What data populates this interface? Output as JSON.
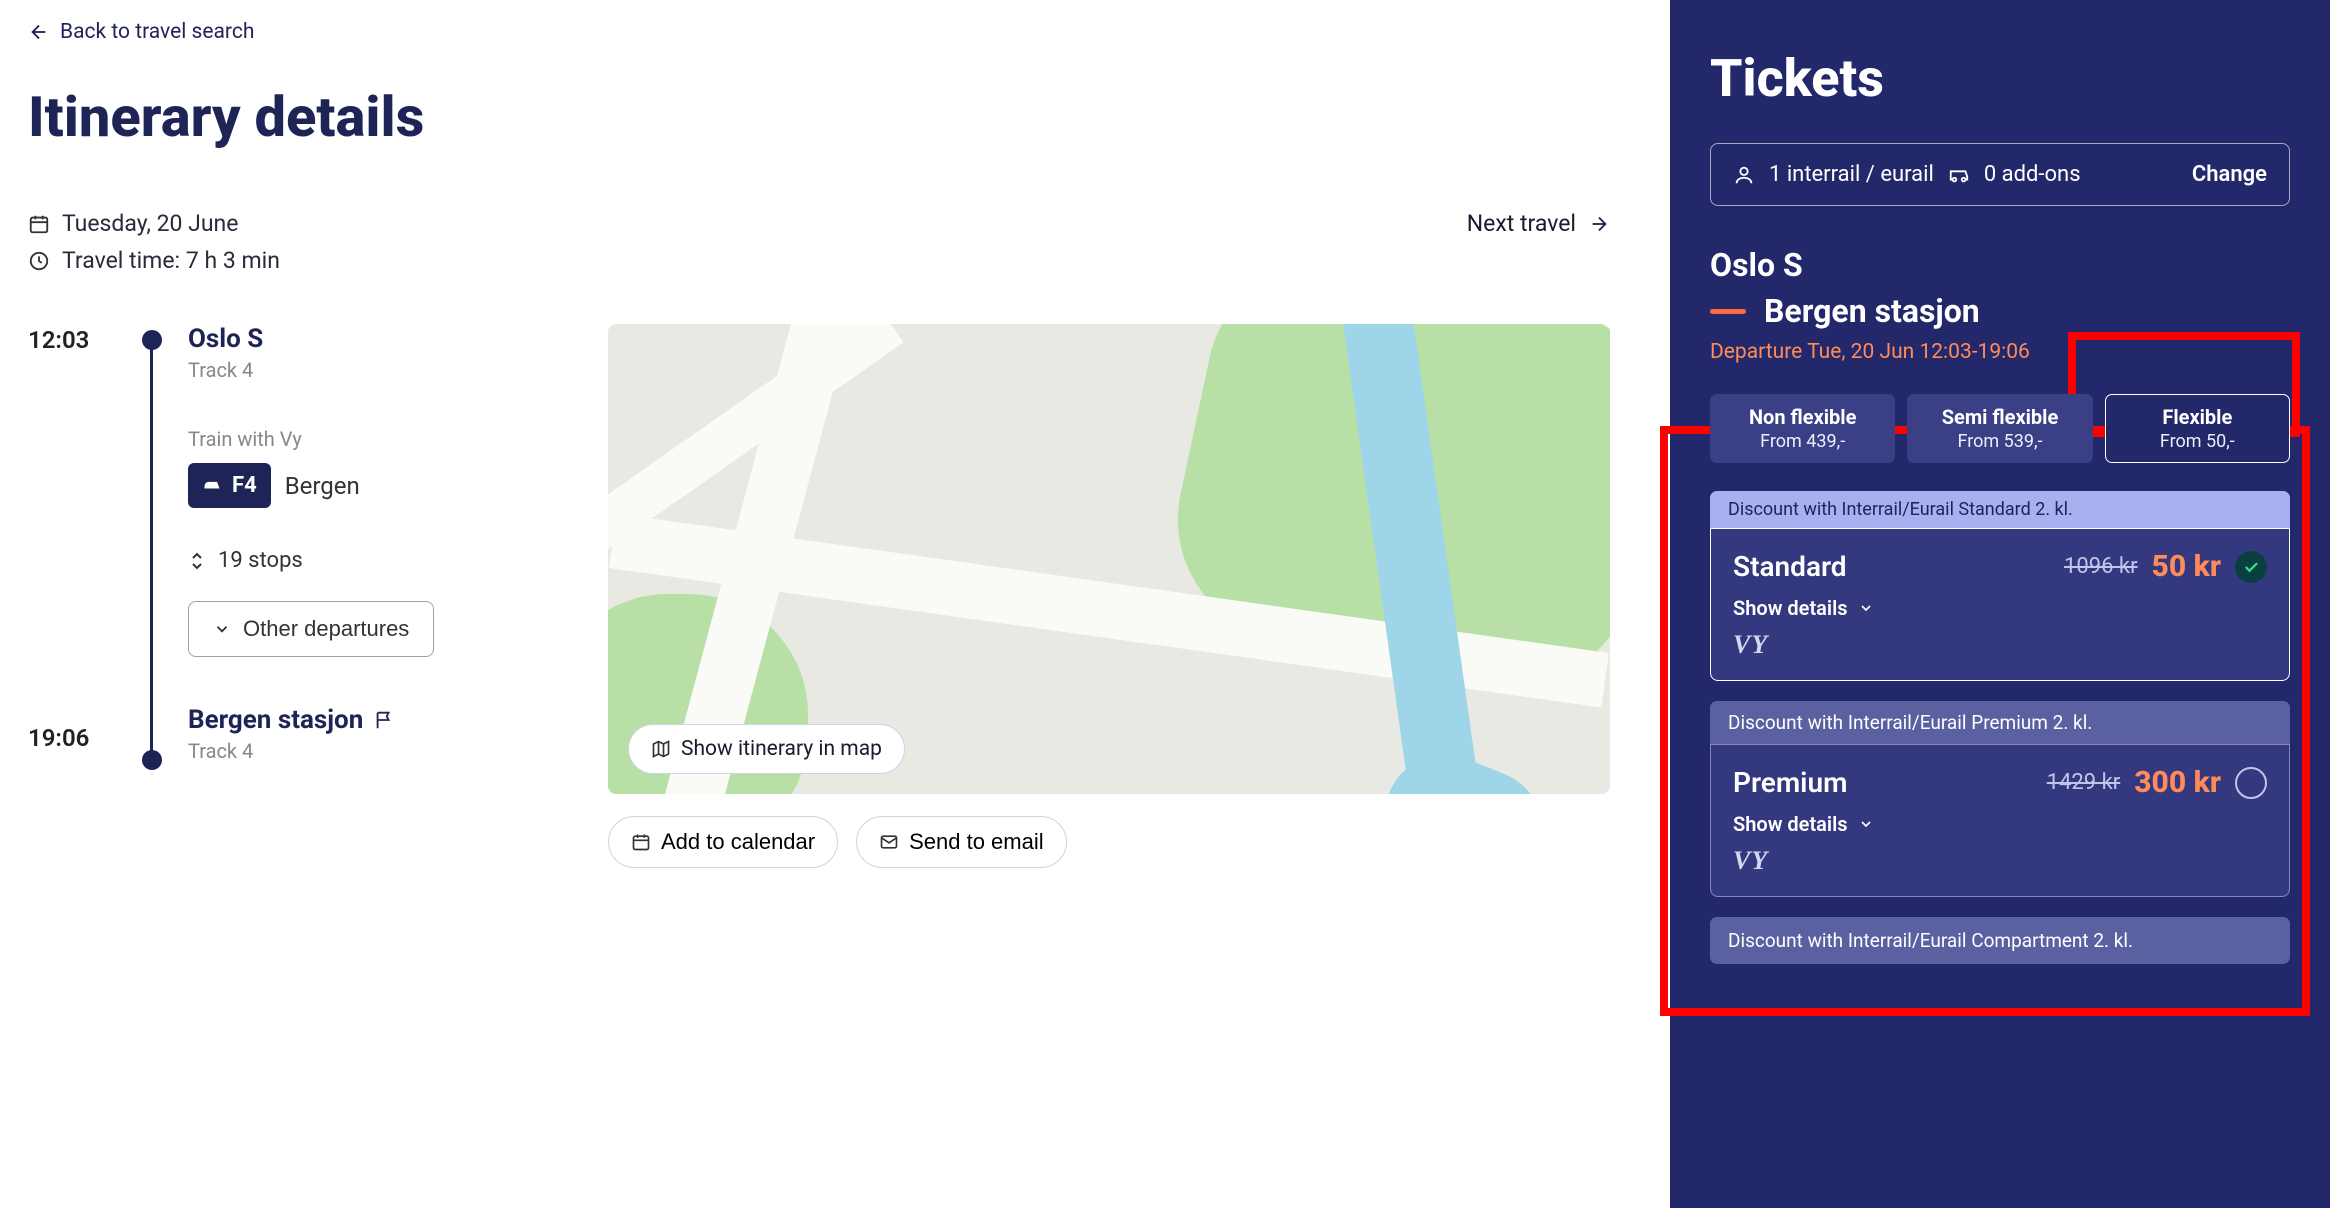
{
  "back_link": "Back to travel search",
  "page_title": "Itinerary details",
  "date": "Tuesday, 20 June",
  "travel_time": "Travel time: 7 h 3 min",
  "next_travel": "Next travel",
  "itinerary": {
    "origin": {
      "time": "12:03",
      "name": "Oslo S",
      "track": "Track 4"
    },
    "operator": "Train with Vy",
    "line_badge": "F4",
    "line_dest": "Bergen",
    "stops_label": "19 stops",
    "other_departures": "Other departures",
    "destination": {
      "time": "19:06",
      "name": "Bergen stasjon",
      "track": "Track 4"
    }
  },
  "map_button": "Show itinerary in map",
  "add_calendar": "Add to calendar",
  "send_email": "Send to email",
  "sidebar": {
    "title": "Tickets",
    "passengers": "1 interrail / eurail",
    "addons": "0 add-ons",
    "change": "Change",
    "from": "Oslo S",
    "to": "Bergen stasjon",
    "departure": "Departure Tue, 20 Jun 12:03-19:06",
    "tabs": [
      {
        "name": "Non flexible",
        "price": "From 439,-"
      },
      {
        "name": "Semi flexible",
        "price": "From 539,-"
      },
      {
        "name": "Flexible",
        "price": "From 50,-"
      }
    ],
    "tickets": [
      {
        "discount": "Discount with Interrail/Eurail Standard 2. kl.",
        "name": "Standard",
        "strike": "1096 kr",
        "price": "50 kr",
        "show_details": "Show details",
        "selected": true
      },
      {
        "discount": "Discount with Interrail/Eurail Premium 2. kl.",
        "name": "Premium",
        "strike": "1429 kr",
        "price": "300 kr",
        "show_details": "Show details",
        "selected": false
      }
    ],
    "trailing_discount": "Discount with Interrail/Eurail Compartment 2. kl."
  }
}
